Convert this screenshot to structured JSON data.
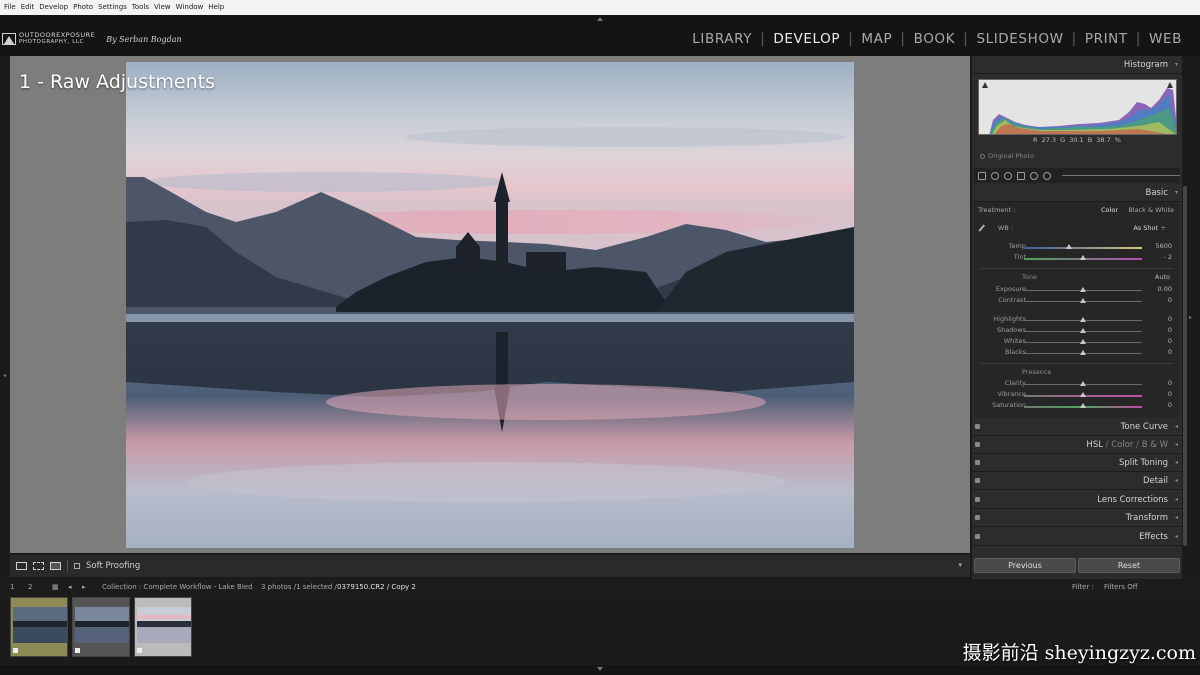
{
  "menubar": {
    "items": [
      "File",
      "Edit",
      "Develop",
      "Photo",
      "Settings",
      "Tools",
      "View",
      "Window",
      "Help"
    ]
  },
  "identity": {
    "line1": "OUTDOOREXPOSURE",
    "line2": "PHOTOGRAPHY, LLC",
    "by": "By Serban Bogdan"
  },
  "modules": [
    {
      "label": "LIBRARY",
      "active": false
    },
    {
      "label": "DEVELOP",
      "active": true
    },
    {
      "label": "MAP",
      "active": false
    },
    {
      "label": "BOOK",
      "active": false
    },
    {
      "label": "SLIDESHOW",
      "active": false
    },
    {
      "label": "PRINT",
      "active": false
    },
    {
      "label": "WEB",
      "active": false
    }
  ],
  "overlay_title": "1 - Raw Adjustments",
  "toolbar": {
    "soft_proofing": "Soft Proofing"
  },
  "histogram": {
    "title": "Histogram",
    "readout": "R 27.3  G 30.1  B 38.7 %",
    "original_photo": "Original Photo"
  },
  "basic": {
    "title": "Basic",
    "treatment_label": "Treatment :",
    "treatment_color": "Color",
    "treatment_bw": "Black & White",
    "wb_label": "WB :",
    "wb_value": "As Shot",
    "tone_label": "Tone",
    "tone_auto": "Auto",
    "presence_label": "Presence",
    "sliders": [
      {
        "name": "Temp",
        "value": "5600",
        "pos": 0.38
      },
      {
        "name": "Tint",
        "value": "- 2",
        "pos": 0.5
      },
      {
        "name": "Exposure",
        "value": "0.00",
        "pos": 0.5
      },
      {
        "name": "Contrast",
        "value": "0",
        "pos": 0.5
      },
      {
        "name": "Highlights",
        "value": "0",
        "pos": 0.5
      },
      {
        "name": "Shadows",
        "value": "0",
        "pos": 0.5
      },
      {
        "name": "Whites",
        "value": "0",
        "pos": 0.5
      },
      {
        "name": "Blacks",
        "value": "0",
        "pos": 0.5
      },
      {
        "name": "Clarity",
        "value": "0",
        "pos": 0.5
      },
      {
        "name": "Vibrance",
        "value": "0",
        "pos": 0.5
      },
      {
        "name": "Saturation",
        "value": "0",
        "pos": 0.5
      }
    ]
  },
  "panels": {
    "tone_curve": "Tone Curve",
    "hsl": "HSL",
    "hsl_sep1": "/",
    "hsl_color": "Color",
    "hsl_sep2": "/",
    "hsl_bw": "B & W",
    "split_toning": "Split Toning",
    "detail": "Detail",
    "lens_corrections": "Lens Corrections",
    "transform": "Transform",
    "effects": "Effects"
  },
  "buttons": {
    "previous": "Previous",
    "reset": "Reset"
  },
  "filmstrip": {
    "page1": "1",
    "page2": "2",
    "collection": "Collection : Complete Workflow - Lake Bled",
    "count": "3 photos /1 selected /",
    "filename": "0379150.CR2 / Copy 2",
    "filter_label": "Filter :",
    "filter_value": "Filters Off"
  },
  "watermark": "摄影前沿 sheyingzyz.com"
}
